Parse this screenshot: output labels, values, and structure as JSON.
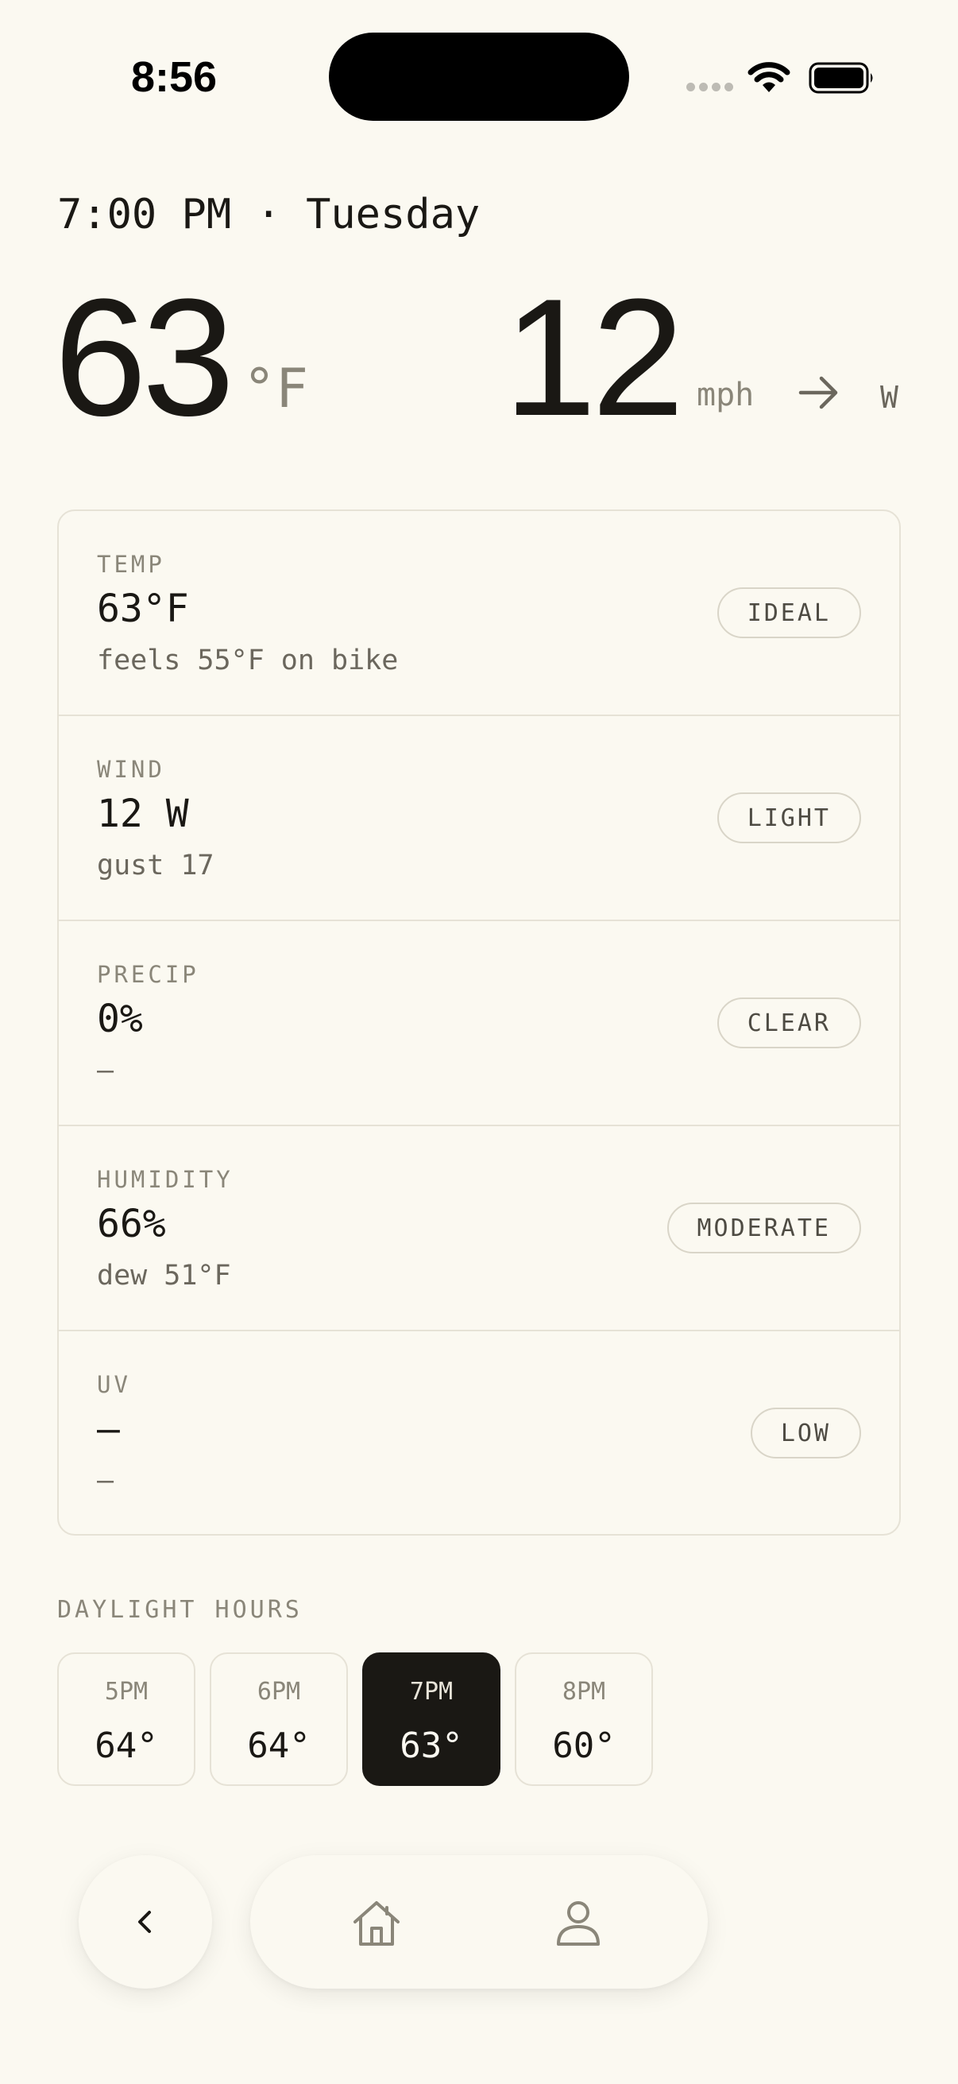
{
  "status_bar": {
    "time": "8:56"
  },
  "header": {
    "datetime": "7:00 PM · Tuesday",
    "temp_value": "63",
    "temp_unit": "°F",
    "wind_value": "12",
    "wind_unit": "mph",
    "wind_direction": "W",
    "wind_arrow_icon": "arrow-right-icon"
  },
  "conditions": [
    {
      "label": "TEMP",
      "value": "63°F",
      "sub": "feels 55°F on bike",
      "badge": "IDEAL"
    },
    {
      "label": "WIND",
      "value": "12 W",
      "sub": "gust 17",
      "badge": "LIGHT"
    },
    {
      "label": "PRECIP",
      "value": "0%",
      "sub": "—",
      "badge": "CLEAR"
    },
    {
      "label": "HUMIDITY",
      "value": "66%",
      "sub": "dew 51°F",
      "badge": "MODERATE"
    },
    {
      "label": "UV",
      "value": "—",
      "sub": "—",
      "badge": "LOW"
    }
  ],
  "daylight": {
    "label": "DAYLIGHT HOURS",
    "hours": [
      {
        "time": "5PM",
        "temp": "64°",
        "selected": false
      },
      {
        "time": "6PM",
        "temp": "64°",
        "selected": false
      },
      {
        "time": "7PM",
        "temp": "63°",
        "selected": true
      },
      {
        "time": "8PM",
        "temp": "60°",
        "selected": false
      }
    ]
  },
  "nav": {
    "back_icon": "chevron-left-icon",
    "home_icon": "home-icon",
    "profile_icon": "user-icon"
  },
  "colors": {
    "background": "#FBF9F1",
    "text": "#1A1814",
    "muted": "#8A8679",
    "border": "#E6E2D6",
    "selected": "#1A1814"
  }
}
